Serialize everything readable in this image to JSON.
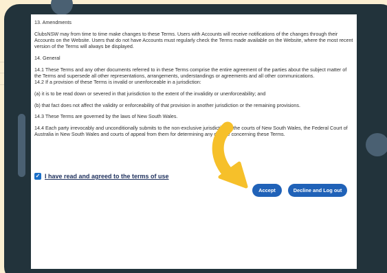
{
  "terms": {
    "heading_amendments": "13. Amendments",
    "para_amendments": "ClubsNSW may from time to time make changes to these Terms. Users with Accounts will receive notifications of the changes through their Accounts on the Website. Users that do not have Accounts must regularly check the Terms made available on the Website, where the most recent version of the Terms will always be displayed.",
    "heading_general": "14. General",
    "para_14_1": "14.1 These Terms and any other documents referred to in these Terms comprise the entire agreement of the parties about the subject matter of the Terms and supersede all other representations, arrangements, understandings or agreements and all other communications.",
    "para_14_2": "14.2 If a provision of these Terms is invalid or unenforceable in a jurisdiction:",
    "para_a": "(a) it is to be read down or severed in that jurisdiction to the extent of the invalidity or unenforceability; and",
    "para_b": "(b) that fact does not affect the validity or enforceability of that provision in another jurisdiction or the remaining provisions.",
    "para_14_3": "14.3 These Terms are governed by the laws of New South Wales.",
    "para_14_4": "14.4 Each party irrevocably and unconditionally submits to the non-exclusive jurisdiction of the courts of New South Wales, the Federal Court of Australia in New South Wales and courts of appeal from them for determining any dispute concerning these Terms."
  },
  "agreement": {
    "checkbox_mark": "✓",
    "checked": true,
    "label": "I have read and agreed to the terms of use"
  },
  "buttons": {
    "accept": "Accept",
    "decline": "Decline and Log out"
  },
  "colors": {
    "background": "#fbefd2",
    "tablet": "#22333b",
    "button": "#2062b8",
    "arrow": "#f6c02a"
  }
}
